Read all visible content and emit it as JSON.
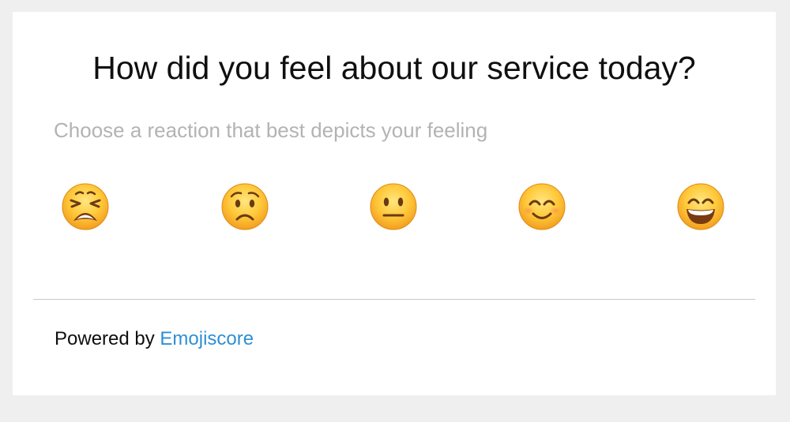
{
  "survey": {
    "question": "How did you feel about our service today?",
    "instruction": "Choose a reaction that best depicts your feeling"
  },
  "reactions": [
    {
      "name": "weary-face-icon"
    },
    {
      "name": "worried-face-icon"
    },
    {
      "name": "neutral-face-icon"
    },
    {
      "name": "smiling-face-icon"
    },
    {
      "name": "grinning-face-icon"
    }
  ],
  "footer": {
    "powered_by_label": "Powered by",
    "brand_link": "Emojiscore"
  },
  "colors": {
    "background": "#efefef",
    "card": "#ffffff",
    "link": "#2e8fd4",
    "placeholder_text": "#b3b3b3"
  }
}
